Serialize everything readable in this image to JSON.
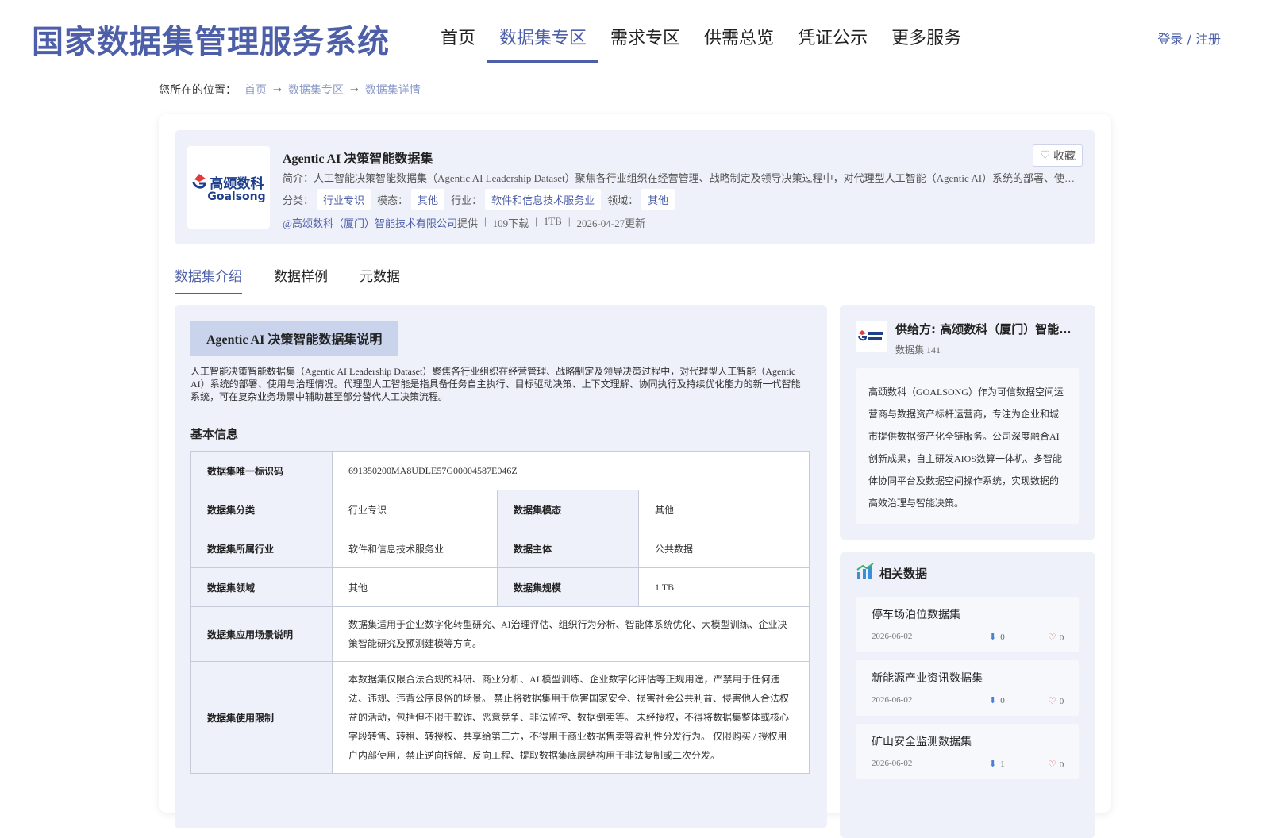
{
  "header": {
    "site_title": "国家数据集管理服务系统",
    "nav": [
      "首页",
      "数据集专区",
      "需求专区",
      "供需总览",
      "凭证公示",
      "更多服务"
    ],
    "active_nav": "数据集专区",
    "login": "登录 / 注册"
  },
  "breadcrumb": {
    "lead": "您所在的位置：",
    "items": [
      "首页",
      "数据集专区",
      "数据集详情"
    ]
  },
  "dataset": {
    "logo_cn": "高颂数科",
    "logo_en": "Goalsong",
    "title": "Agentic AI 决策智能数据集",
    "intro": "简介：人工智能决策智能数据集（Agentic AI Leadership Dataset）聚焦各行业组织在经营管理、战略制定及领导决策过程中，对代理型人工智能（Agentic AI）系统的部署、使用与治理情况。代理型人工智能是指具备任务自主执行、目标驱动决策、上下文理解、协同执行及持续优化能力的新一代智能系统",
    "favorite": "收藏",
    "tags": [
      {
        "key": "分类：",
        "value": "行业专识"
      },
      {
        "key": "模态：",
        "value": "其他"
      },
      {
        "key": "行业：",
        "value": "软件和信息技术服务业"
      },
      {
        "key": "领域：",
        "value": "其他"
      }
    ],
    "provider": "@高颂数科（厦门）智能技术有限公司",
    "provider_suffix": "提供",
    "downloads": "109下载",
    "size": "1TB",
    "updated": "2026-04-27更新"
  },
  "tabs": [
    "数据集介绍",
    "数据样例",
    "元数据"
  ],
  "main": {
    "section_title": "Agentic AI 决策智能数据集说明",
    "description": "人工智能决策智能数据集（Agentic AI Leadership Dataset）聚焦各行业组织在经营管理、战略制定及领导决策过程中，对代理型人工智能（Agentic AI）系统的部署、使用与治理情况。代理型人工智能是指具备任务自主执行、目标驱动决策、上下文理解、协同执行及持续优化能力的新一代智能系统，可在复杂业务场景中辅助甚至部分替代人工决策流程。",
    "basic_title": "基本信息",
    "table": {
      "uid_label": "数据集唯一标识码",
      "uid_value": "691350200MA8UDLE57G00004587E046Z",
      "category_label": "数据集分类",
      "category_value": "行业专识",
      "modality_label": "数据集模态",
      "modality_value": "其他",
      "industry_label": "数据集所属行业",
      "industry_value": "软件和信息技术服务业",
      "subject_label": "数据主体",
      "subject_value": "公共数据",
      "domain_label": "数据集领域",
      "domain_value": "其他",
      "scale_label": "数据集规模",
      "scale_value": "1 TB",
      "scenario_label": "数据集应用场景说明",
      "scenario_value": "数据集适用于企业数字化转型研究、AI治理评估、组织行为分析、智能体系统优化、大模型训练、企业决策智能研究及预测建模等方向。",
      "restrict_label": "数据集使用限制",
      "restrict_value": "本数据集仅限合法合规的科研、商业分析、AI 模型训练、企业数字化评估等正规用途，严禁用于任何违法、违规、违背公序良俗的场景。 禁止将数据集用于危害国家安全、损害社会公共利益、侵害他人合法权益的活动，包括但不限于欺诈、恶意竞争、非法监控、数据倒卖等。 未经授权，不得将数据集整体或核心字段转售、转租、转授权、共享给第三方，不得用于商业数据售卖等盈利性分发行为。 仅限购买 / 授权用户内部使用，禁止逆向拆解、反向工程、提取数据集底层结构用于非法复制或二次分发。"
    }
  },
  "supplier": {
    "name": "供给方: 高颂数科（厦门）智能技术有限公司",
    "count": "数据集 141",
    "description": "高颂数科（GOALSONG）作为可信数据空间运营商与数据资产标杆运营商，专注为企业和城市提供数据资产化全链服务。公司深度融合AI创新成果，自主研发AIOS数算一体机、多智能体协同平台及数据空间操作系统，实现数据的高效治理与智能决策。"
  },
  "related": {
    "title": "相关数据",
    "items": [
      {
        "name": "停车场泊位数据集",
        "date": "2026-06-02",
        "downloads": "0",
        "likes": "0"
      },
      {
        "name": "新能源产业资讯数据集",
        "date": "2026-06-02",
        "downloads": "0",
        "likes": "0"
      },
      {
        "name": "矿山安全监测数据集",
        "date": "2026-06-02",
        "downloads": "1",
        "likes": "0"
      }
    ]
  },
  "colors": {
    "accent": "#4d5fa8",
    "panel": "#eef1fa",
    "like": "#e0605a",
    "download": "#4d7fd6"
  }
}
